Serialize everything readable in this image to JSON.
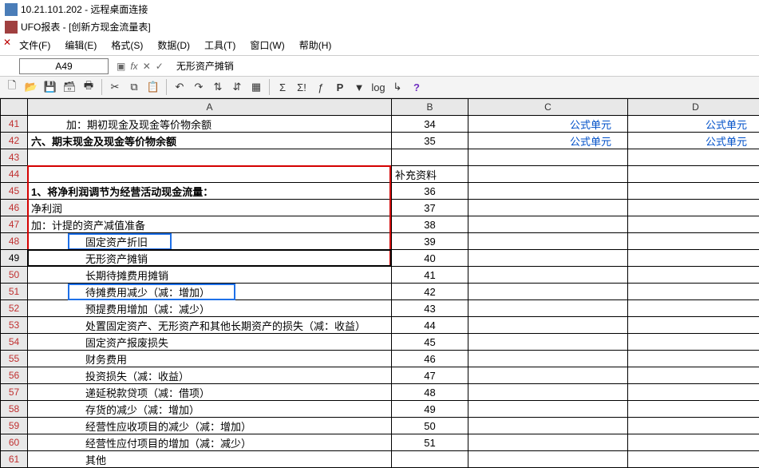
{
  "window": {
    "rdp_title": "10.21.101.202 - 远程桌面连接",
    "app_title": "UFO报表 - [创新方现金流量表]"
  },
  "menu": {
    "file": "文件(F)",
    "edit": "编辑(E)",
    "format": "格式(S)",
    "data": "数据(D)",
    "tool": "工具(T)",
    "window": "窗口(W)",
    "help": "帮助(H)"
  },
  "namebox": {
    "cell": "A49"
  },
  "formula": {
    "text": "无形资产摊销"
  },
  "link_text": "公式单元",
  "columns": [
    "A",
    "B",
    "C",
    "D"
  ],
  "rows": [
    {
      "n": 41,
      "a": "加：期初现金及现金等价物余额",
      "a_cls": "indent1",
      "b": "34",
      "c_link": true,
      "d_link": true
    },
    {
      "n": 42,
      "a": "六、期末现金及现金等价物余额",
      "a_cls": "bold",
      "b": "35",
      "c_link": true,
      "d_link": true
    },
    {
      "n": 43,
      "a": "",
      "b": ""
    },
    {
      "n": 44,
      "a": "",
      "b": "补充资料",
      "b_left": true
    },
    {
      "n": 45,
      "a": "1、将净利润调节为经营活动现金流量：",
      "a_cls": "bold",
      "b": "36"
    },
    {
      "n": 46,
      "a": "净利润",
      "b": "37"
    },
    {
      "n": 47,
      "a": "加：计提的资产减值准备",
      "b": "38"
    },
    {
      "n": 48,
      "a": "固定资产折旧",
      "a_cls": "indent2",
      "b": "39"
    },
    {
      "n": 49,
      "a": "无形资产摊销",
      "a_cls": "indent2",
      "b": "40",
      "selected": true
    },
    {
      "n": 50,
      "a": "长期待摊费用摊销",
      "a_cls": "indent2",
      "b": "41"
    },
    {
      "n": 51,
      "a": "待摊费用减少（减：增加）",
      "a_cls": "indent2",
      "b": "42"
    },
    {
      "n": 52,
      "a": "预提费用增加（减：减少）",
      "a_cls": "indent2",
      "b": "43"
    },
    {
      "n": 53,
      "a": "处置固定资产、无形资产和其他长期资产的损失（减：收益）",
      "a_cls": "indent2",
      "b": "44"
    },
    {
      "n": 54,
      "a": "固定资产报废损失",
      "a_cls": "indent2",
      "b": "45"
    },
    {
      "n": 55,
      "a": "财务费用",
      "a_cls": "indent2",
      "b": "46"
    },
    {
      "n": 56,
      "a": "投资损失（减：收益）",
      "a_cls": "indent2",
      "b": "47"
    },
    {
      "n": 57,
      "a": "递延税款贷项（减：借项）",
      "a_cls": "indent2",
      "b": "48"
    },
    {
      "n": 58,
      "a": "存货的减少（减：增加）",
      "a_cls": "indent2",
      "b": "49"
    },
    {
      "n": 59,
      "a": "经营性应收项目的减少（减：增加）",
      "a_cls": "indent2",
      "b": "50"
    },
    {
      "n": 60,
      "a": "经营性应付项目的增加（减：减少）",
      "a_cls": "indent2",
      "b": "51"
    },
    {
      "n": 61,
      "a": "其他",
      "a_cls": "indent2",
      "b": ""
    }
  ],
  "toolbar_icons": [
    "new",
    "open",
    "save",
    "save-all",
    "print",
    "cut",
    "copy",
    "paste",
    "undo",
    "redo",
    "sort-asc",
    "sort-desc",
    "filter",
    "sigma",
    "sigma2",
    "func",
    "bold-p",
    "flag",
    "log",
    "ruler",
    "help"
  ]
}
